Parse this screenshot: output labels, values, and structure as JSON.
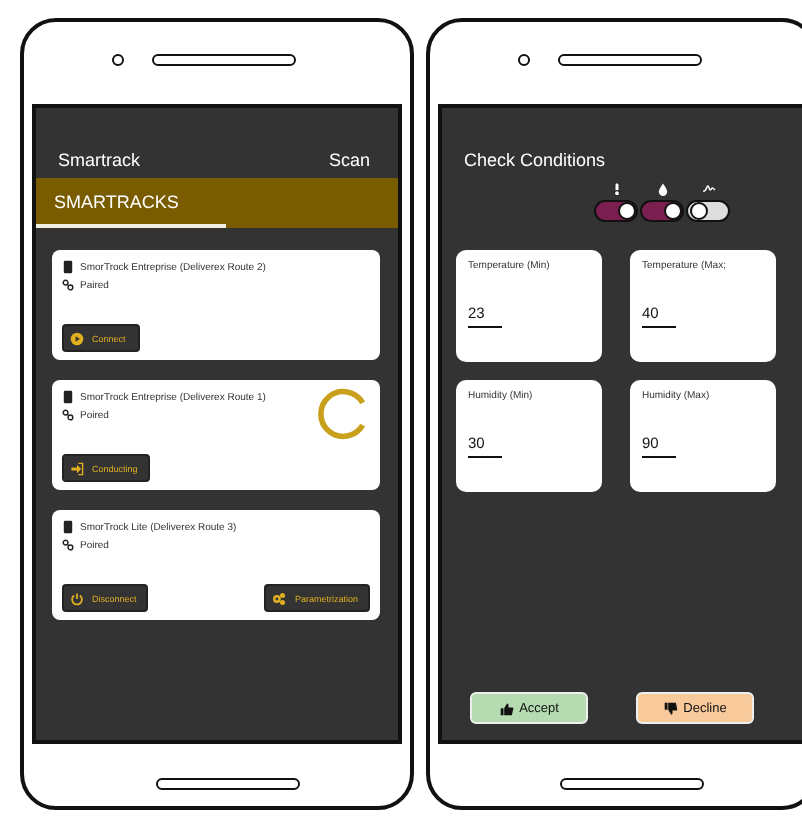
{
  "left_screen": {
    "title": "Smartrack",
    "action": "Scan",
    "tabs": [
      {
        "label": "SMARTRACKS",
        "selected": true
      }
    ],
    "devices": [
      {
        "name": "SmorTrock Entreprise (Deliverex Route 2)",
        "status": "Paired",
        "busy": false,
        "buttons": [
          {
            "kind": "connect",
            "label": "Connect"
          }
        ]
      },
      {
        "name": "SmorTrock Entreprise (Deliverex Route 1)",
        "status": "Poired",
        "busy": true,
        "buttons": [
          {
            "kind": "connecting",
            "label": "Conducting"
          }
        ]
      },
      {
        "name": "SmorTrock Lite (Deliverex Route 3)",
        "status": "Poired",
        "busy": false,
        "buttons": [
          {
            "kind": "disconnect",
            "label": "Disconnect"
          },
          {
            "kind": "parameters",
            "label": "Parametrization"
          }
        ]
      }
    ]
  },
  "right_screen": {
    "title": "Check Conditions",
    "toggles": [
      {
        "kind": "temperature",
        "on": true
      },
      {
        "kind": "humidity",
        "on": true
      },
      {
        "kind": "shock",
        "on": false
      }
    ],
    "fields": [
      {
        "label": "Temperature (Min)",
        "value": "23"
      },
      {
        "label": "Temperature (Max;",
        "value": "40"
      },
      {
        "label": "Humidity (Min)",
        "value": "30"
      },
      {
        "label": "Humidity (Max)",
        "value": "90"
      }
    ],
    "actions": [
      {
        "kind": "accept",
        "label": "Accept"
      },
      {
        "kind": "decline",
        "label": "Decline"
      }
    ]
  }
}
